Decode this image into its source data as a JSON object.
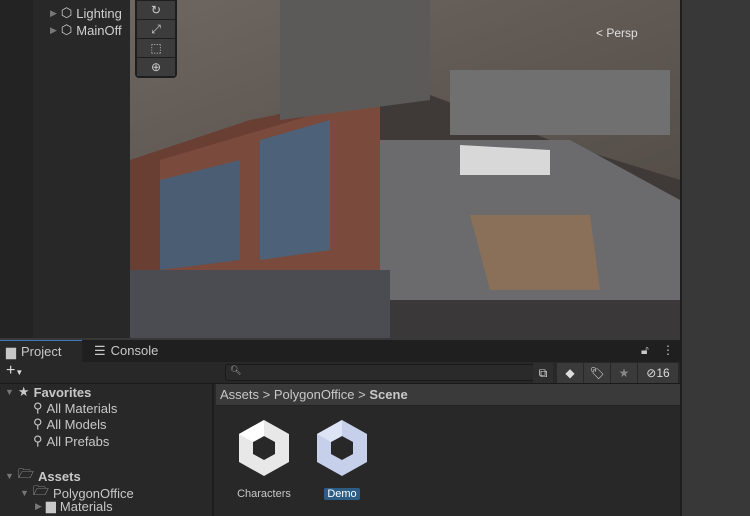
{
  "hierarchy": {
    "items": [
      {
        "label": "Lighting"
      },
      {
        "label": "MainOff"
      }
    ]
  },
  "scene": {
    "camera_label": "Persp",
    "tools": [
      "rotate-tool",
      "scale-tool",
      "rect-tool",
      "transform-tool"
    ]
  },
  "tabs": [
    {
      "label": "Project",
      "active": true
    },
    {
      "label": "Console",
      "active": false
    }
  ],
  "toolbar": {
    "add_label": "+",
    "search_placeholder": "",
    "hidden_count": "16"
  },
  "sidebar": {
    "favorites": {
      "label": "Favorites",
      "items": [
        "All Materials",
        "All Models",
        "All Prefabs"
      ]
    },
    "assets": {
      "label": "Assets",
      "children": [
        {
          "label": "PolygonOffice",
          "children": [
            {
              "label": "Materials"
            }
          ]
        }
      ]
    }
  },
  "breadcrumb": [
    "Assets",
    "PolygonOffice",
    "Scene"
  ],
  "assets": [
    {
      "label": "Characters",
      "selected": false
    },
    {
      "label": "Demo",
      "selected": true
    }
  ],
  "colors": {
    "selection": "#2c5d87",
    "accent": "#3a79bb"
  }
}
